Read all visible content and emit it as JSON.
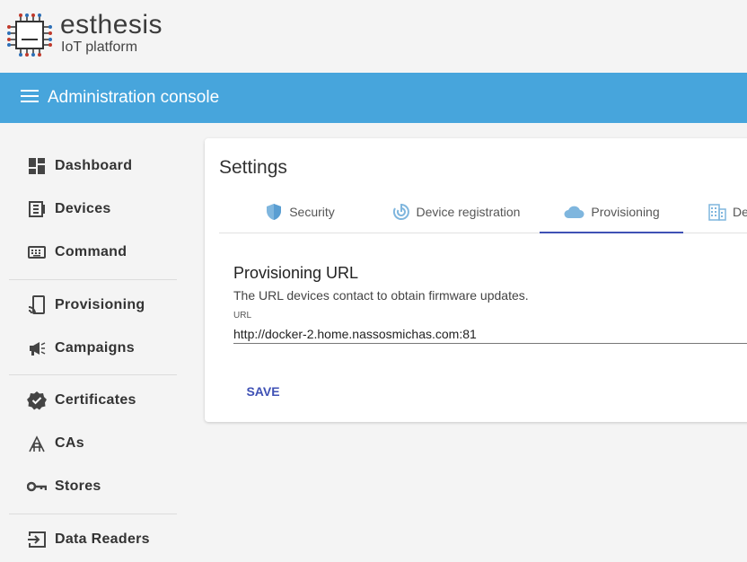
{
  "brand": {
    "name": "esthesis",
    "subtitle": "IoT platform"
  },
  "topbar": {
    "title": "Administration console"
  },
  "sidebar": {
    "items": [
      {
        "label": "Dashboard",
        "icon": "dashboard-icon"
      },
      {
        "label": "Devices",
        "icon": "devices-icon"
      },
      {
        "label": "Command",
        "icon": "keyboard-icon"
      },
      {
        "label": "Provisioning",
        "icon": "provisioning-icon"
      },
      {
        "label": "Campaigns",
        "icon": "megaphone-icon"
      },
      {
        "label": "Certificates",
        "icon": "verified-badge-icon"
      },
      {
        "label": "CAs",
        "icon": "ca-tree-icon"
      },
      {
        "label": "Stores",
        "icon": "key-icon"
      },
      {
        "label": "Data Readers",
        "icon": "input-arrow-icon"
      }
    ]
  },
  "settings": {
    "title": "Settings",
    "tabs": [
      {
        "label": "Security",
        "icon": "shield-icon",
        "active": false
      },
      {
        "label": "Device registration",
        "icon": "target-icon",
        "active": false
      },
      {
        "label": "Provisioning",
        "icon": "cloud-icon",
        "active": true
      },
      {
        "label": "De",
        "icon": "building-icon",
        "active": false
      }
    ],
    "section": {
      "title": "Provisioning URL",
      "description": "The URL devices contact to obtain firmware updates.",
      "field_label": "URL",
      "field_value": "http://docker-2.home.nassosmichas.com:81"
    },
    "save_label": "SAVE"
  },
  "colors": {
    "topbar": "#47a5dc",
    "accent": "#3f51b5",
    "icon_blue": "#7fb6de"
  }
}
